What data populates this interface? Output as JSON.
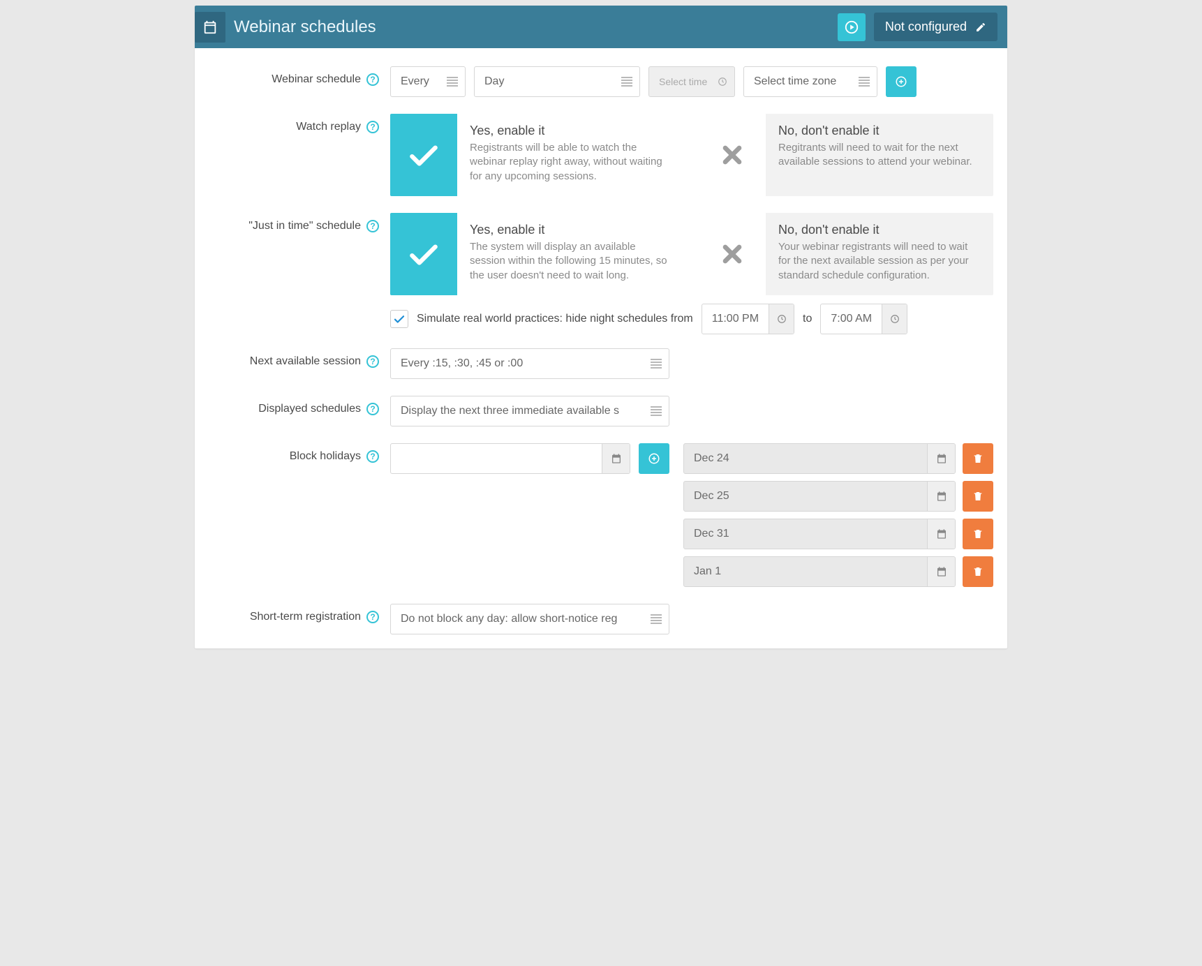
{
  "header": {
    "title": "Webinar schedules",
    "status": "Not configured"
  },
  "schedule": {
    "label": "Webinar schedule",
    "every": "Every",
    "unit": "Day",
    "time_placeholder": "Select time",
    "timezone": "Select time zone"
  },
  "replay": {
    "label": "Watch replay",
    "yes_title": "Yes, enable it",
    "yes_desc": "Registrants will be able to watch the webinar replay right away, without waiting for any upcoming sessions.",
    "no_title": "No, don't enable it",
    "no_desc": "Regitrants will need to wait for the next available sessions to attend your webinar."
  },
  "jit": {
    "label": "\"Just in time\" schedule",
    "yes_title": "Yes, enable it",
    "yes_desc": "The system will display an available session within the following 15 minutes, so the user doesn't need to wait long.",
    "no_title": "No, don't enable it",
    "no_desc": "Your webinar registrants will need to wait for the next available session as per your standard schedule configuration."
  },
  "simulate": {
    "text": "Simulate real world practices: hide night schedules from",
    "from": "11:00 PM",
    "to_word": "to",
    "to": "7:00 AM"
  },
  "next_session": {
    "label": "Next available session",
    "value": "Every :15, :30, :45 or :00"
  },
  "displayed": {
    "label": "Displayed schedules",
    "value": "Display the next three immediate available s"
  },
  "holidays": {
    "label": "Block holidays",
    "items": [
      "Dec 24",
      "Dec 25",
      "Dec 31",
      "Jan 1"
    ]
  },
  "shortterm": {
    "label": "Short-term registration",
    "value": "Do not block any day: allow short-notice reg"
  }
}
